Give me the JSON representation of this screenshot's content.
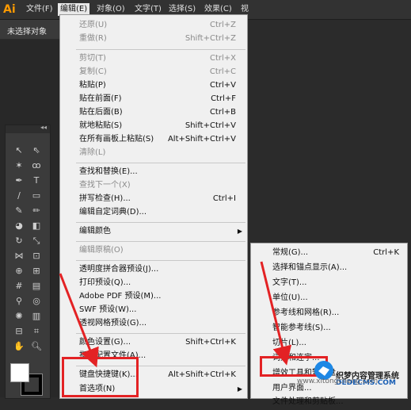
{
  "app": {
    "logo": "Ai"
  },
  "menubar": {
    "items": [
      {
        "label": "文件(F)"
      },
      {
        "label": "编辑(E)",
        "active": true
      },
      {
        "label": "对象(O)"
      },
      {
        "label": "文字(T)"
      },
      {
        "label": "选择(S)"
      },
      {
        "label": "效果(C)"
      },
      {
        "label": "视"
      }
    ]
  },
  "controlbar": {
    "status": "未选择对象"
  },
  "edit_menu": {
    "items": [
      {
        "label": "还原(U)",
        "shortcut": "Ctrl+Z",
        "disabled": true
      },
      {
        "label": "重做(R)",
        "shortcut": "Shift+Ctrl+Z",
        "disabled": true
      },
      {
        "label": "剪切(T)",
        "shortcut": "Ctrl+X",
        "disabled": true
      },
      {
        "label": "复制(C)",
        "shortcut": "Ctrl+C",
        "disabled": true
      },
      {
        "label": "粘贴(P)",
        "shortcut": "Ctrl+V",
        "disabled": false
      },
      {
        "label": "贴在前面(F)",
        "shortcut": "Ctrl+F",
        "disabled": false
      },
      {
        "label": "贴在后面(B)",
        "shortcut": "Ctrl+B",
        "disabled": false
      },
      {
        "label": "就地粘贴(S)",
        "shortcut": "Shift+Ctrl+V",
        "disabled": false
      },
      {
        "label": "在所有画板上粘贴(S)",
        "shortcut": "Alt+Shift+Ctrl+V",
        "disabled": false
      },
      {
        "label": "清除(L)",
        "shortcut": "",
        "disabled": true
      },
      {
        "label": "查找和替换(E)...",
        "shortcut": "",
        "disabled": false
      },
      {
        "label": "查找下一个(X)",
        "shortcut": "",
        "disabled": true
      },
      {
        "label": "拼写检查(H)...",
        "shortcut": "Ctrl+I",
        "disabled": false
      },
      {
        "label": "编辑自定词典(D)...",
        "shortcut": "",
        "disabled": false
      },
      {
        "label": "编辑颜色",
        "shortcut": "",
        "disabled": false,
        "submenu": true
      },
      {
        "label": "编辑原稿(O)",
        "shortcut": "",
        "disabled": true
      },
      {
        "label": "透明度拼合器预设(J)...",
        "shortcut": "",
        "disabled": false
      },
      {
        "label": "打印预设(Q)...",
        "shortcut": "",
        "disabled": false
      },
      {
        "label": "Adobe PDF 预设(M)...",
        "shortcut": "",
        "disabled": false
      },
      {
        "label": "SWF 预设(W)...",
        "shortcut": "",
        "disabled": false
      },
      {
        "label": "透视网格预设(G)...",
        "shortcut": "",
        "disabled": false
      },
      {
        "label": "颜色设置(G)...",
        "shortcut": "Shift+Ctrl+K",
        "disabled": false
      },
      {
        "label": "指定配置文件(A)...",
        "shortcut": "",
        "disabled": false
      },
      {
        "label": "键盘快捷键(K)...",
        "shortcut": "Alt+Shift+Ctrl+K",
        "disabled": false
      },
      {
        "label": "首选项(N)",
        "shortcut": "",
        "disabled": false,
        "submenu": true
      }
    ]
  },
  "prefs_submenu": {
    "items": [
      {
        "label": "常规(G)...",
        "shortcut": "Ctrl+K"
      },
      {
        "label": "选择和锚点显示(A)...",
        "shortcut": ""
      },
      {
        "label": "文字(T)...",
        "shortcut": ""
      },
      {
        "label": "单位(U)...",
        "shortcut": ""
      },
      {
        "label": "参考线和网格(R)...",
        "shortcut": ""
      },
      {
        "label": "智能参考线(S)...",
        "shortcut": ""
      },
      {
        "label": "切片(L)...",
        "shortcut": ""
      },
      {
        "label": "词典和连字...",
        "shortcut": ""
      },
      {
        "label": "增效工具和暂存盘...",
        "shortcut": ""
      },
      {
        "label": "用户界面...",
        "shortcut": ""
      },
      {
        "label": "文件处理和剪贴板...",
        "shortcut": ""
      }
    ]
  },
  "watermark": {
    "name": "织梦内容管理系统",
    "url": "DEDECMS.COM",
    "under": "www.xitongcheng.com"
  },
  "colors": {
    "highlight": "#e32224",
    "menu_bg": "#f0f0f0",
    "app_bg": "#2b2b2b"
  }
}
